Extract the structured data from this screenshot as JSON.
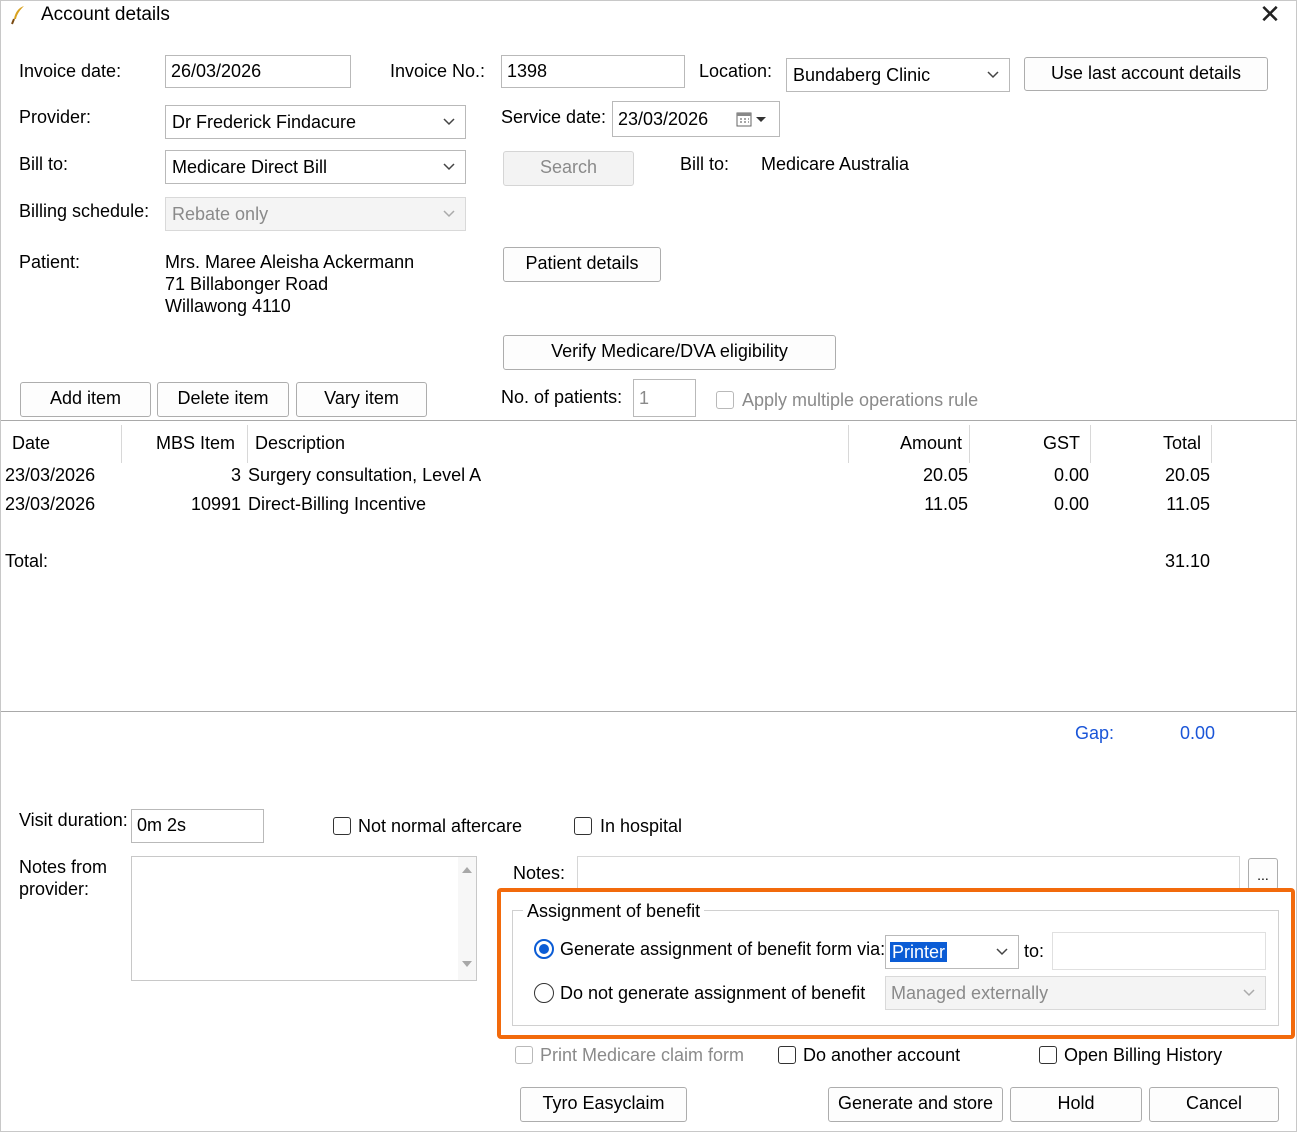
{
  "window": {
    "title": "Account details",
    "close_glyph": "✕"
  },
  "header": {
    "invoice_date_label": "Invoice date:",
    "invoice_date_value": "26/03/2026",
    "invoice_no_label": "Invoice No.:",
    "invoice_no_value": "1398",
    "location_label": "Location:",
    "location_value": "Bundaberg Clinic",
    "use_last_button": "Use last account details",
    "provider_label": "Provider:",
    "provider_value": "Dr Frederick Findacure",
    "service_date_label": "Service date:",
    "service_date_value": "23/03/2026",
    "bill_to_label": "Bill to:",
    "bill_to_value": "Medicare Direct Bill",
    "search_button": "Search",
    "bill_to_label2": "Bill to:",
    "bill_to_value2": "Medicare Australia",
    "billing_schedule_label": "Billing schedule:",
    "billing_schedule_value": "Rebate only",
    "patient_label": "Patient:",
    "patient_name": "Mrs. Maree Aleisha Ackermann",
    "patient_address1": "71 Billabonger Road",
    "patient_address2": "Willawong  4110",
    "patient_details_button": "Patient details",
    "verify_button": "Verify Medicare/DVA eligibility",
    "add_item_button": "Add item",
    "delete_item_button": "Delete item",
    "vary_item_button": "Vary item",
    "no_patients_label": "No. of patients:",
    "no_patients_value": "1",
    "multiple_ops_label": "Apply multiple operations rule"
  },
  "table": {
    "columns": [
      "Date",
      "MBS Item",
      "Description",
      "Amount",
      "GST",
      "Total"
    ],
    "rows": [
      {
        "date": "23/03/2026",
        "item": "3",
        "description": "Surgery consultation, Level A",
        "amount": "20.05",
        "gst": "0.00",
        "total": "20.05"
      },
      {
        "date": "23/03/2026",
        "item": "10991",
        "description": "Direct-Billing Incentive",
        "amount": "11.05",
        "gst": "0.00",
        "total": "11.05"
      }
    ],
    "total_label": "Total:",
    "total_value": "31.10"
  },
  "gap": {
    "label": "Gap:",
    "value": "0.00",
    "color": "#1a55d8"
  },
  "footer": {
    "visit_duration_label": "Visit duration:",
    "visit_duration_value": "0m  2s",
    "not_normal_aftercare": "Not normal aftercare",
    "in_hospital": "In hospital",
    "notes_from_provider_label_1": "Notes from",
    "notes_from_provider_label_2": "provider:",
    "notes_label": "Notes:",
    "notes_more_button": "...",
    "aob_group_title": "Assignment of benefit",
    "aob_generate_label": "Generate assignment of benefit form via:",
    "aob_via_value": "Printer",
    "aob_to_label": "to:",
    "aob_do_not_label": "Do not generate assignment of benefit",
    "aob_managed_value": "Managed externally",
    "print_medicare_claim": "Print Medicare claim form",
    "do_another_account": "Do another account",
    "open_billing_history": "Open Billing History",
    "tyro_button": "Tyro Easyclaim",
    "generate_store_button": "Generate and store",
    "hold_button": "Hold",
    "cancel_button": "Cancel"
  },
  "colors": {
    "highlight": "#f26a0c",
    "selection": "#0b5cd5"
  }
}
